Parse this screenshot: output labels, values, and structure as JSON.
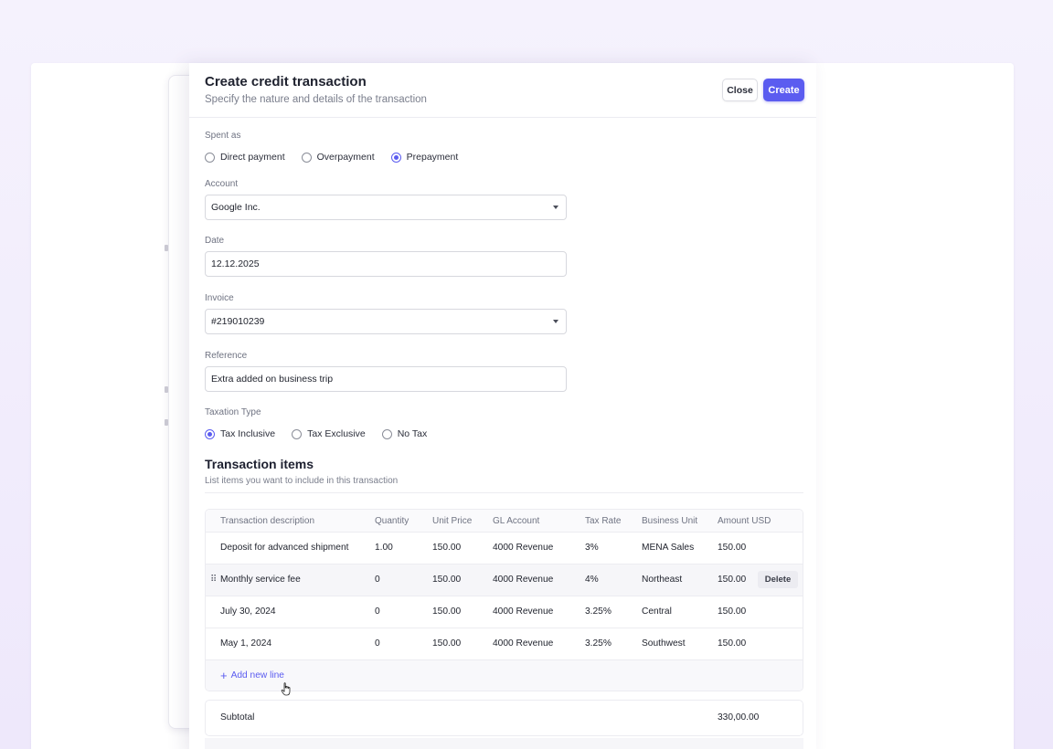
{
  "modal": {
    "title": "Create credit transaction",
    "subtitle": "Specify the nature and details of the transaction",
    "close_label": "Close",
    "create_label": "Create"
  },
  "spent_as": {
    "label": "Spent as",
    "options": [
      "Direct payment",
      "Overpayment",
      "Prepayment"
    ],
    "selected": "Prepayment"
  },
  "account": {
    "label": "Account",
    "value": "Google Inc."
  },
  "date": {
    "label": "Date",
    "value": "12.12.2025"
  },
  "invoice": {
    "label": "Invoice",
    "value": "#219010239"
  },
  "reference": {
    "label": "Reference",
    "value": "Extra added on business trip"
  },
  "taxation": {
    "label": "Taxation Type",
    "options": [
      "Tax Inclusive",
      "Tax Exclusive",
      "No Tax"
    ],
    "selected": "Tax Inclusive"
  },
  "items": {
    "title": "Transaction items",
    "subtitle": "List items you want to include in this transaction",
    "columns": [
      "Transaction description",
      "Quantity",
      "Unit Price",
      "GL Account",
      "Tax Rate",
      "Business Unit",
      "Amount USD"
    ],
    "rows": [
      [
        "Deposit for advanced shipment",
        "1.00",
        "150.00",
        "4000 Revenue",
        "3%",
        "MENA Sales",
        "150.00"
      ],
      [
        "Monthly service fee",
        "0",
        "150.00",
        "4000 Revenue",
        "4%",
        "Northeast",
        "150.00"
      ],
      [
        "July 30, 2024",
        "0",
        "150.00",
        "4000 Revenue",
        "3.25%",
        "Central",
        "150.00"
      ],
      [
        "May 1, 2024",
        "0",
        "150.00",
        "4000 Revenue",
        "3.25%",
        "Southwest",
        "150.00"
      ]
    ],
    "delete_label": "Delete",
    "add_line_label": "Add new line"
  },
  "subtotal": {
    "label": "Subtotal",
    "value": "330,00.00"
  },
  "colors": {
    "accent": "#5b5cf0",
    "background": "#f3effd"
  }
}
